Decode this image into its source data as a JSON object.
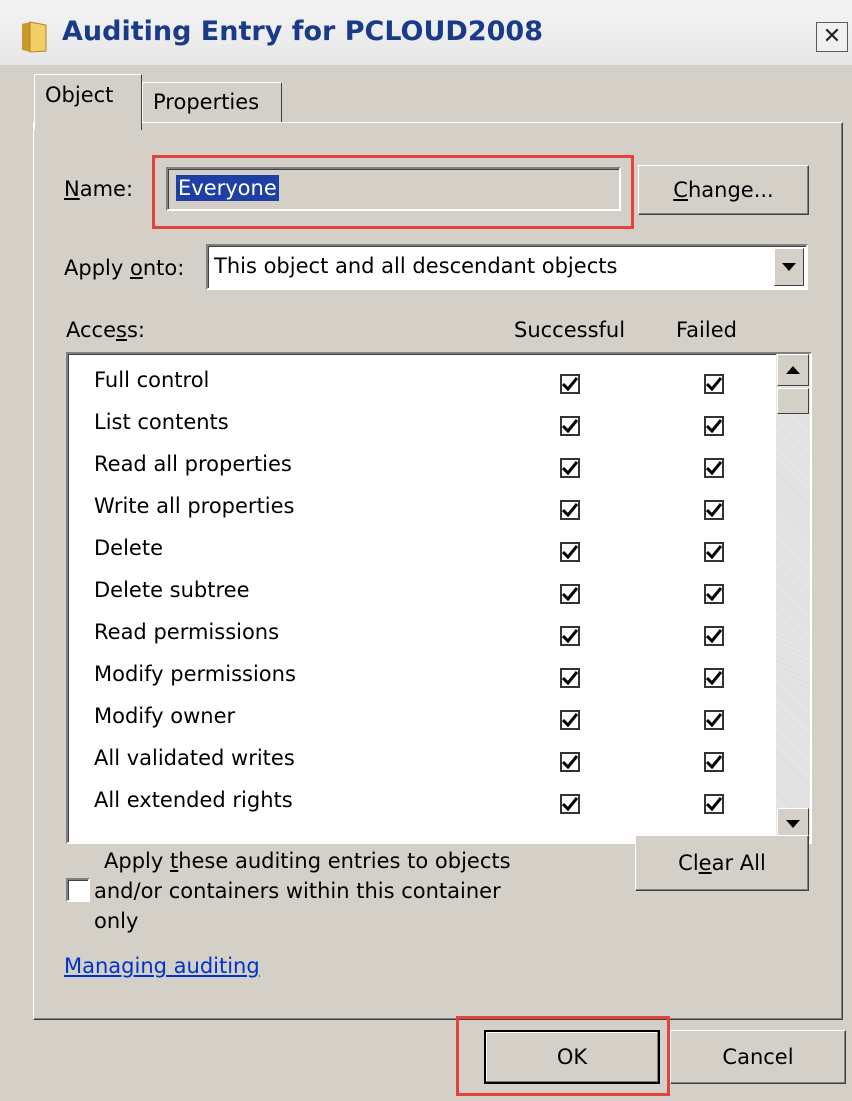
{
  "window": {
    "title": "Auditing Entry for PCLOUD2008",
    "close_label": "✕"
  },
  "tabs": [
    {
      "label": "Object",
      "active": true
    },
    {
      "label": "Properties",
      "active": false
    }
  ],
  "name": {
    "label_accel": "N",
    "label_rest": "ame:",
    "value": "Everyone",
    "change_accel": "C",
    "change_rest": "hange..."
  },
  "apply_onto": {
    "label_pre": "Apply ",
    "label_accel": "o",
    "label_post": "nto:",
    "value": "This object and all descendant objects"
  },
  "access": {
    "label_pre": "Acce",
    "label_accel": "s",
    "label_post": "s:",
    "col_successful": "Successful",
    "col_failed": "Failed",
    "rows": [
      {
        "label": "Full control",
        "successful": true,
        "failed": true
      },
      {
        "label": "List contents",
        "successful": true,
        "failed": true
      },
      {
        "label": "Read all properties",
        "successful": true,
        "failed": true
      },
      {
        "label": "Write all properties",
        "successful": true,
        "failed": true
      },
      {
        "label": "Delete",
        "successful": true,
        "failed": true
      },
      {
        "label": "Delete subtree",
        "successful": true,
        "failed": true
      },
      {
        "label": "Read permissions",
        "successful": true,
        "failed": true
      },
      {
        "label": "Modify permissions",
        "successful": true,
        "failed": true
      },
      {
        "label": "Modify owner",
        "successful": true,
        "failed": true
      },
      {
        "label": "All validated writes",
        "successful": true,
        "failed": true
      },
      {
        "label": "All extended rights",
        "successful": true,
        "failed": true
      }
    ]
  },
  "apply_container": {
    "checked": false,
    "line1_pre": "Apply ",
    "line1_accel": "t",
    "line1_post": "hese auditing entries to objects",
    "line2": "and/or containers within this container",
    "line3": "only"
  },
  "clear_all": {
    "pre": "Cl",
    "accel": "e",
    "post": "ar All"
  },
  "link": "Managing auditing",
  "buttons": {
    "ok": "OK",
    "cancel": "Cancel"
  },
  "colors": {
    "highlight": "#e0443d",
    "title_text": "#1a3b87",
    "selection": "#1f3fa5",
    "link": "#0033cc"
  }
}
